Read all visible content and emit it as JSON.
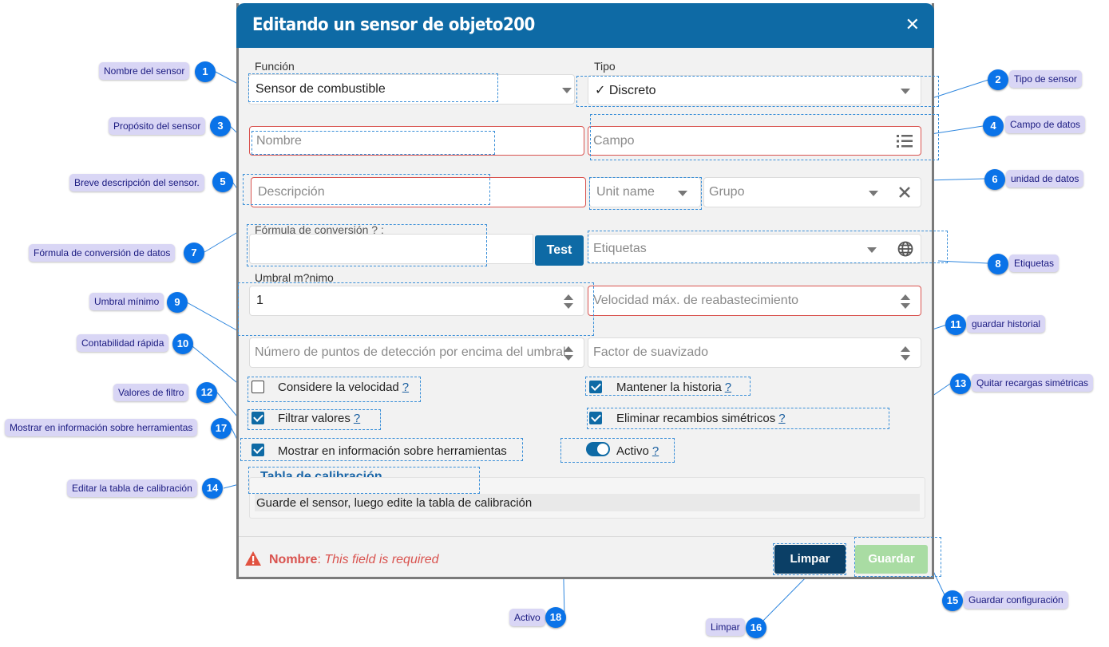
{
  "dialog": {
    "title": "Editando un sensor de objeto200",
    "close_glyph": "✕"
  },
  "form": {
    "funcion_label": "Función",
    "funcion_value": "Sensor de combustible",
    "tipo_label": "Tipo",
    "tipo_value": "✓ Discreto",
    "nombre_placeholder": "Nombre",
    "campo_placeholder": "Campo",
    "descripcion_placeholder": "Descripción",
    "unit_placeholder": "Unit name",
    "grupo_placeholder": "Grupo",
    "formula_label": "Fórmula de conversión ? :",
    "formula_value": "",
    "test_label": "Test",
    "etiquetas_placeholder": "Etiquetas",
    "umbral_label": "Umbral m?nimo",
    "umbral_value": "1",
    "velocidad_placeholder": "Velocidad máx. de reabastecimiento",
    "puntos_placeholder": "Número de puntos de detección por encima del umbral",
    "suavizado_placeholder": "Factor de suavizado",
    "checkboxes": {
      "velocidad": {
        "label": "Considere la velocidad",
        "help": "?",
        "checked": false
      },
      "historia": {
        "label": "Mantener la historia",
        "help": "?",
        "checked": true
      },
      "filtrar": {
        "label": "Filtrar valores",
        "help": "?",
        "checked": true
      },
      "simetricos": {
        "label": "Eliminar recambios simétricos",
        "help": "?",
        "checked": true
      },
      "tooltip": {
        "label": "Mostrar en información sobre herramientas",
        "help": "?",
        "checked": true
      }
    },
    "activo": {
      "label": "Activo",
      "help": "?",
      "on": true
    },
    "calibration": {
      "title": "Tabla de calibración",
      "message": "Guarde el sensor, luego edite la tabla de calibración"
    },
    "error": {
      "field": "Nombre",
      "separator": ":",
      "message": "This field is required"
    },
    "limpiar_label": "Limpar",
    "guardar_label": "Guardar"
  },
  "callouts": [
    {
      "n": "1",
      "text": "Nombre del sensor"
    },
    {
      "n": "2",
      "text": "Tipo de sensor"
    },
    {
      "n": "3",
      "text": "Propósito del sensor"
    },
    {
      "n": "4",
      "text": "Campo de datos"
    },
    {
      "n": "5",
      "text": "Breve descripción del sensor."
    },
    {
      "n": "6",
      "text": "unidad de datos"
    },
    {
      "n": "7",
      "text": "Fórmula de conversión de datos"
    },
    {
      "n": "8",
      "text": "Etiquetas"
    },
    {
      "n": "9",
      "text": "Umbral mínimo"
    },
    {
      "n": "10",
      "text": "Contabilidad rápida"
    },
    {
      "n": "11",
      "text": "guardar historial"
    },
    {
      "n": "12",
      "text": "Valores de filtro"
    },
    {
      "n": "13",
      "text": "Quitar recargas simétricas"
    },
    {
      "n": "14",
      "text": "Editar la tabla de calibración"
    },
    {
      "n": "15",
      "text": "Guardar configuración"
    },
    {
      "n": "16",
      "text": "Limpar"
    },
    {
      "n": "17",
      "text": "Mostrar en información sobre herramientas"
    },
    {
      "n": "18",
      "text": "Activo"
    }
  ],
  "colors": {
    "header": "#0e6aa5",
    "accent": "#0e6aa5",
    "error": "#d9534f",
    "badge": "#0a73e8",
    "note_bg": "#d9d6f5",
    "disabled_button": "#a9dca3"
  }
}
